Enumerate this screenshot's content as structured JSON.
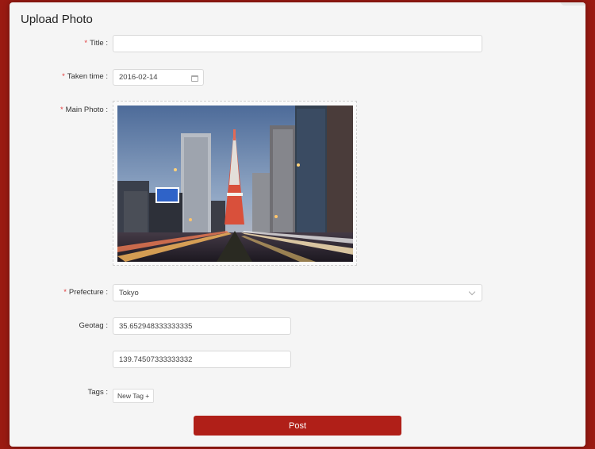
{
  "dialog": {
    "title": "Upload Photo"
  },
  "form": {
    "required_marker": "*",
    "title": {
      "label": "Title :",
      "value": ""
    },
    "taken_time": {
      "label": "Taken time :",
      "value": "2016-02-14",
      "icon": "calendar-icon"
    },
    "main_photo": {
      "label": "Main Photo :",
      "alt": "Tokyo Tower street at dusk"
    },
    "prefecture": {
      "label": "Prefecture :",
      "value": "Tokyo",
      "icon": "chevron-down-icon"
    },
    "geotag": {
      "label": "Geotag :",
      "latitude": "35.652948333333335",
      "longitude": "139.74507333333332"
    },
    "tags": {
      "label": "Tags :",
      "new_tag_label": "New Tag +"
    },
    "post_label": "Post"
  },
  "colors": {
    "background": "#9a1a12",
    "accent": "#b01f18",
    "required": "#e0393a"
  }
}
